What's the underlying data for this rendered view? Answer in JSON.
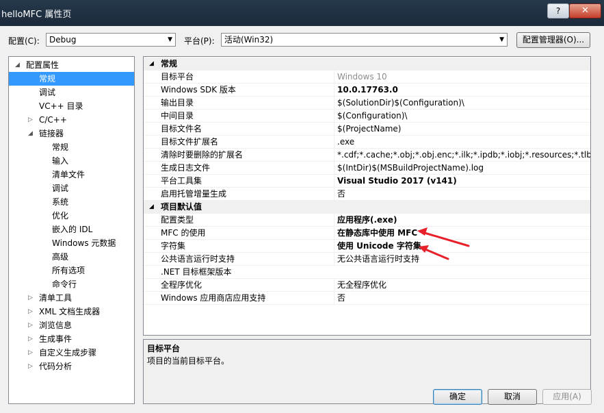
{
  "window": {
    "title": "helloMFC 属性页",
    "help_label": "?",
    "close_label": "✕"
  },
  "toolbar": {
    "config_label": "配置(C):",
    "config_value": "Debug",
    "platform_label": "平台(P):",
    "platform_value": "活动(Win32)",
    "config_manager_label": "配置管理器(O)..."
  },
  "tree": {
    "items": [
      {
        "label": "配置属性",
        "level": 0,
        "expander": "◢"
      },
      {
        "label": "常规",
        "level": 1,
        "selected": true
      },
      {
        "label": "调试",
        "level": 1
      },
      {
        "label": "VC++ 目录",
        "level": 1
      },
      {
        "label": "C/C++",
        "level": 1,
        "expander": "▷"
      },
      {
        "label": "链接器",
        "level": 1,
        "expander": "◢"
      },
      {
        "label": "常规",
        "level": 2
      },
      {
        "label": "输入",
        "level": 2
      },
      {
        "label": "清单文件",
        "level": 2
      },
      {
        "label": "调试",
        "level": 2
      },
      {
        "label": "系统",
        "level": 2
      },
      {
        "label": "优化",
        "level": 2
      },
      {
        "label": "嵌入的 IDL",
        "level": 2
      },
      {
        "label": "Windows 元数据",
        "level": 2
      },
      {
        "label": "高级",
        "level": 2
      },
      {
        "label": "所有选项",
        "level": 2
      },
      {
        "label": "命令行",
        "level": 2
      },
      {
        "label": "清单工具",
        "level": 1,
        "expander": "▷"
      },
      {
        "label": "XML 文档生成器",
        "level": 1,
        "expander": "▷"
      },
      {
        "label": "浏览信息",
        "level": 1,
        "expander": "▷"
      },
      {
        "label": "生成事件",
        "level": 1,
        "expander": "▷"
      },
      {
        "label": "自定义生成步骤",
        "level": 1,
        "expander": "▷"
      },
      {
        "label": "代码分析",
        "level": 1,
        "expander": "▷"
      }
    ]
  },
  "grid": {
    "rows": [
      {
        "cat": true,
        "name": "常规",
        "expander": "◢"
      },
      {
        "name": "目标平台",
        "value": "Windows 10",
        "style": "gray"
      },
      {
        "name": "Windows SDK 版本",
        "value": "10.0.17763.0",
        "style": "bold"
      },
      {
        "name": "输出目录",
        "value": "$(SolutionDir)$(Configuration)\\"
      },
      {
        "name": "中间目录",
        "value": "$(Configuration)\\"
      },
      {
        "name": "目标文件名",
        "value": "$(ProjectName)"
      },
      {
        "name": "目标文件扩展名",
        "value": ".exe"
      },
      {
        "name": "清除时要删除的扩展名",
        "value": "*.cdf;*.cache;*.obj;*.obj.enc;*.ilk;*.ipdb;*.iobj;*.resources;*.tlb;*.tli;*.t"
      },
      {
        "name": "生成日志文件",
        "value": "$(IntDir)$(MSBuildProjectName).log"
      },
      {
        "name": "平台工具集",
        "value": "Visual Studio 2017 (v141)",
        "style": "bold"
      },
      {
        "name": "启用托管增量生成",
        "value": "否"
      },
      {
        "cat": true,
        "name": "项目默认值",
        "expander": "◢"
      },
      {
        "name": "配置类型",
        "value": "应用程序(.exe)",
        "style": "bold"
      },
      {
        "name": "MFC 的使用",
        "value": "在静态库中使用 MFC",
        "style": "bold"
      },
      {
        "name": "字符集",
        "value": "使用 Unicode 字符集",
        "style": "bold"
      },
      {
        "name": "公共语言运行时支持",
        "value": "无公共语言运行时支持"
      },
      {
        "name": ".NET 目标框架版本",
        "value": ""
      },
      {
        "name": "全程序优化",
        "value": "无全程序优化"
      },
      {
        "name": "Windows 应用商店应用支持",
        "value": "否"
      }
    ]
  },
  "description": {
    "title": "目标平台",
    "text": "项目的当前目标平台。"
  },
  "buttons": {
    "ok": "确定",
    "cancel": "取消",
    "apply": "应用(A)"
  },
  "colors": {
    "selection": "#3399ff",
    "annotation_arrow": "#e8202a"
  }
}
